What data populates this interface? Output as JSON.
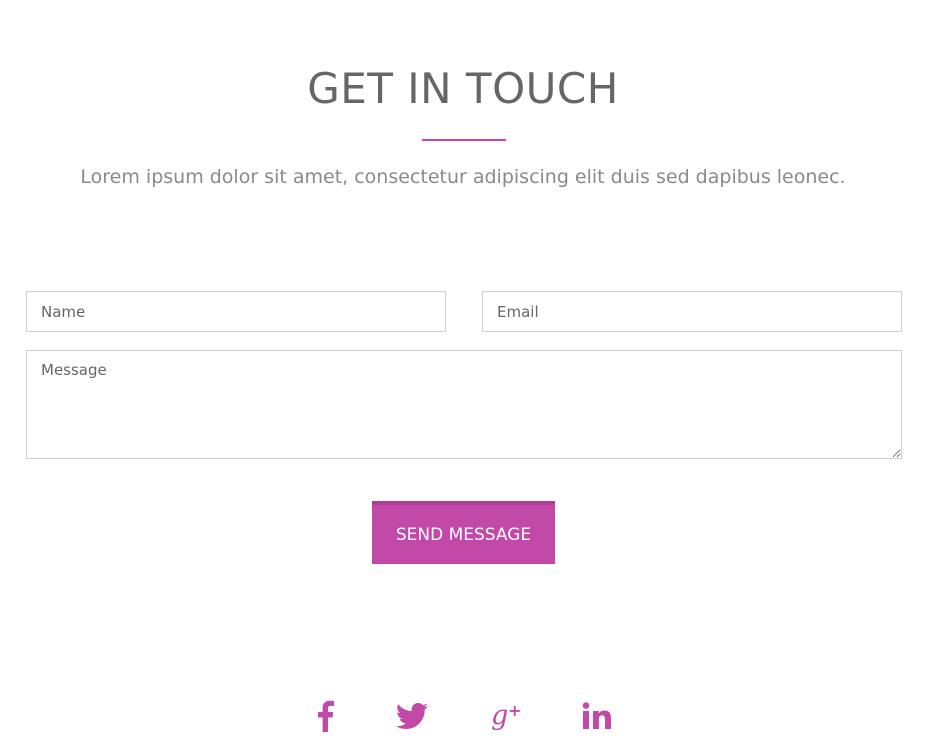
{
  "section": {
    "title": "GET IN TOUCH",
    "subtitle": "Lorem ipsum dolor sit amet, consectetur adipiscing elit duis sed dapibus leonec."
  },
  "form": {
    "name_placeholder": "Name",
    "email_placeholder": "Email",
    "message_placeholder": "Message",
    "submit_label": "SEND MESSAGE"
  },
  "social": {
    "icons": [
      "facebook-icon",
      "twitter-icon",
      "google-plus-icon",
      "linkedin-icon"
    ]
  },
  "colors": {
    "accent": "#c349a8",
    "heading": "#666666",
    "subtitle": "#8a8a8a",
    "field_border": "#cfcfcf"
  }
}
